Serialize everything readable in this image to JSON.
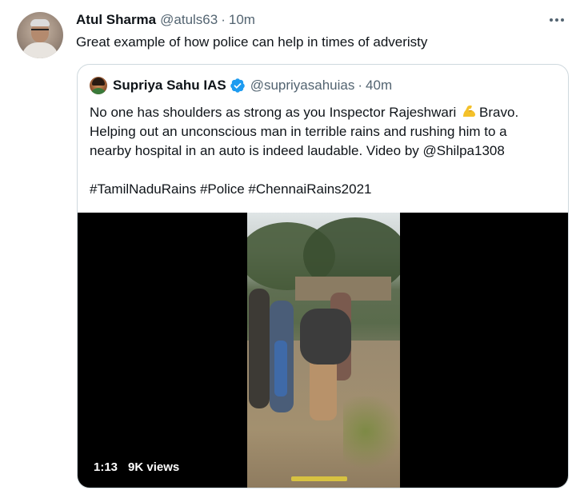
{
  "tweet": {
    "author_name": "Atul Sharma",
    "author_handle": "@atuls63",
    "separator": "·",
    "time": "10m",
    "text": "Great example of how police can help in times of adveristy"
  },
  "quoted_tweet": {
    "author_name": "Supriya Sahu IAS",
    "author_handle": "@supriyasahuias",
    "separator": "·",
    "time": "40m",
    "verified": true,
    "body_lines": [
      {
        "before_emoji": "No one has shoulders as strong as you Inspector Rajeshwari ",
        "emoji": "flexed-biceps",
        "after_emoji": "Bravo."
      },
      {
        "text": "Helping out an unconscious man in terrible rains and rushing him to a"
      },
      {
        "text": "nearby hospital in an auto is indeed laudable. Video by @Shilpa1308"
      }
    ],
    "hashtags": "#TamilNaduRains #Police #ChennaiRains2021",
    "video": {
      "duration": "1:13",
      "views": "9K views"
    }
  },
  "icons": {
    "more": "more-options-icon",
    "verified": "verified-badge-icon",
    "emoji": "flexed-biceps-emoji"
  },
  "colors": {
    "text_primary": "#0f1419",
    "text_secondary": "#536471",
    "verified_blue": "#1d9bf0",
    "border": "#cfd9de",
    "video_bg": "#000000"
  }
}
